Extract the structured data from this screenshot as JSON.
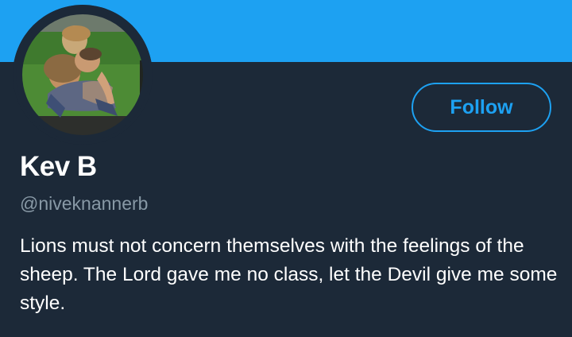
{
  "colors": {
    "banner": "#1da1f2",
    "background": "#1c2938",
    "accent": "#1da1f2",
    "text_primary": "#ffffff",
    "text_secondary": "#8899a6"
  },
  "profile": {
    "avatar_icon": "profile-photo",
    "display_name": "Kev B",
    "handle": "@niveknannerb",
    "bio": "Lions must not concern themselves with the feelings of the sheep. The Lord gave me no class, let the Devil give me some style."
  },
  "actions": {
    "follow_label": "Follow"
  }
}
